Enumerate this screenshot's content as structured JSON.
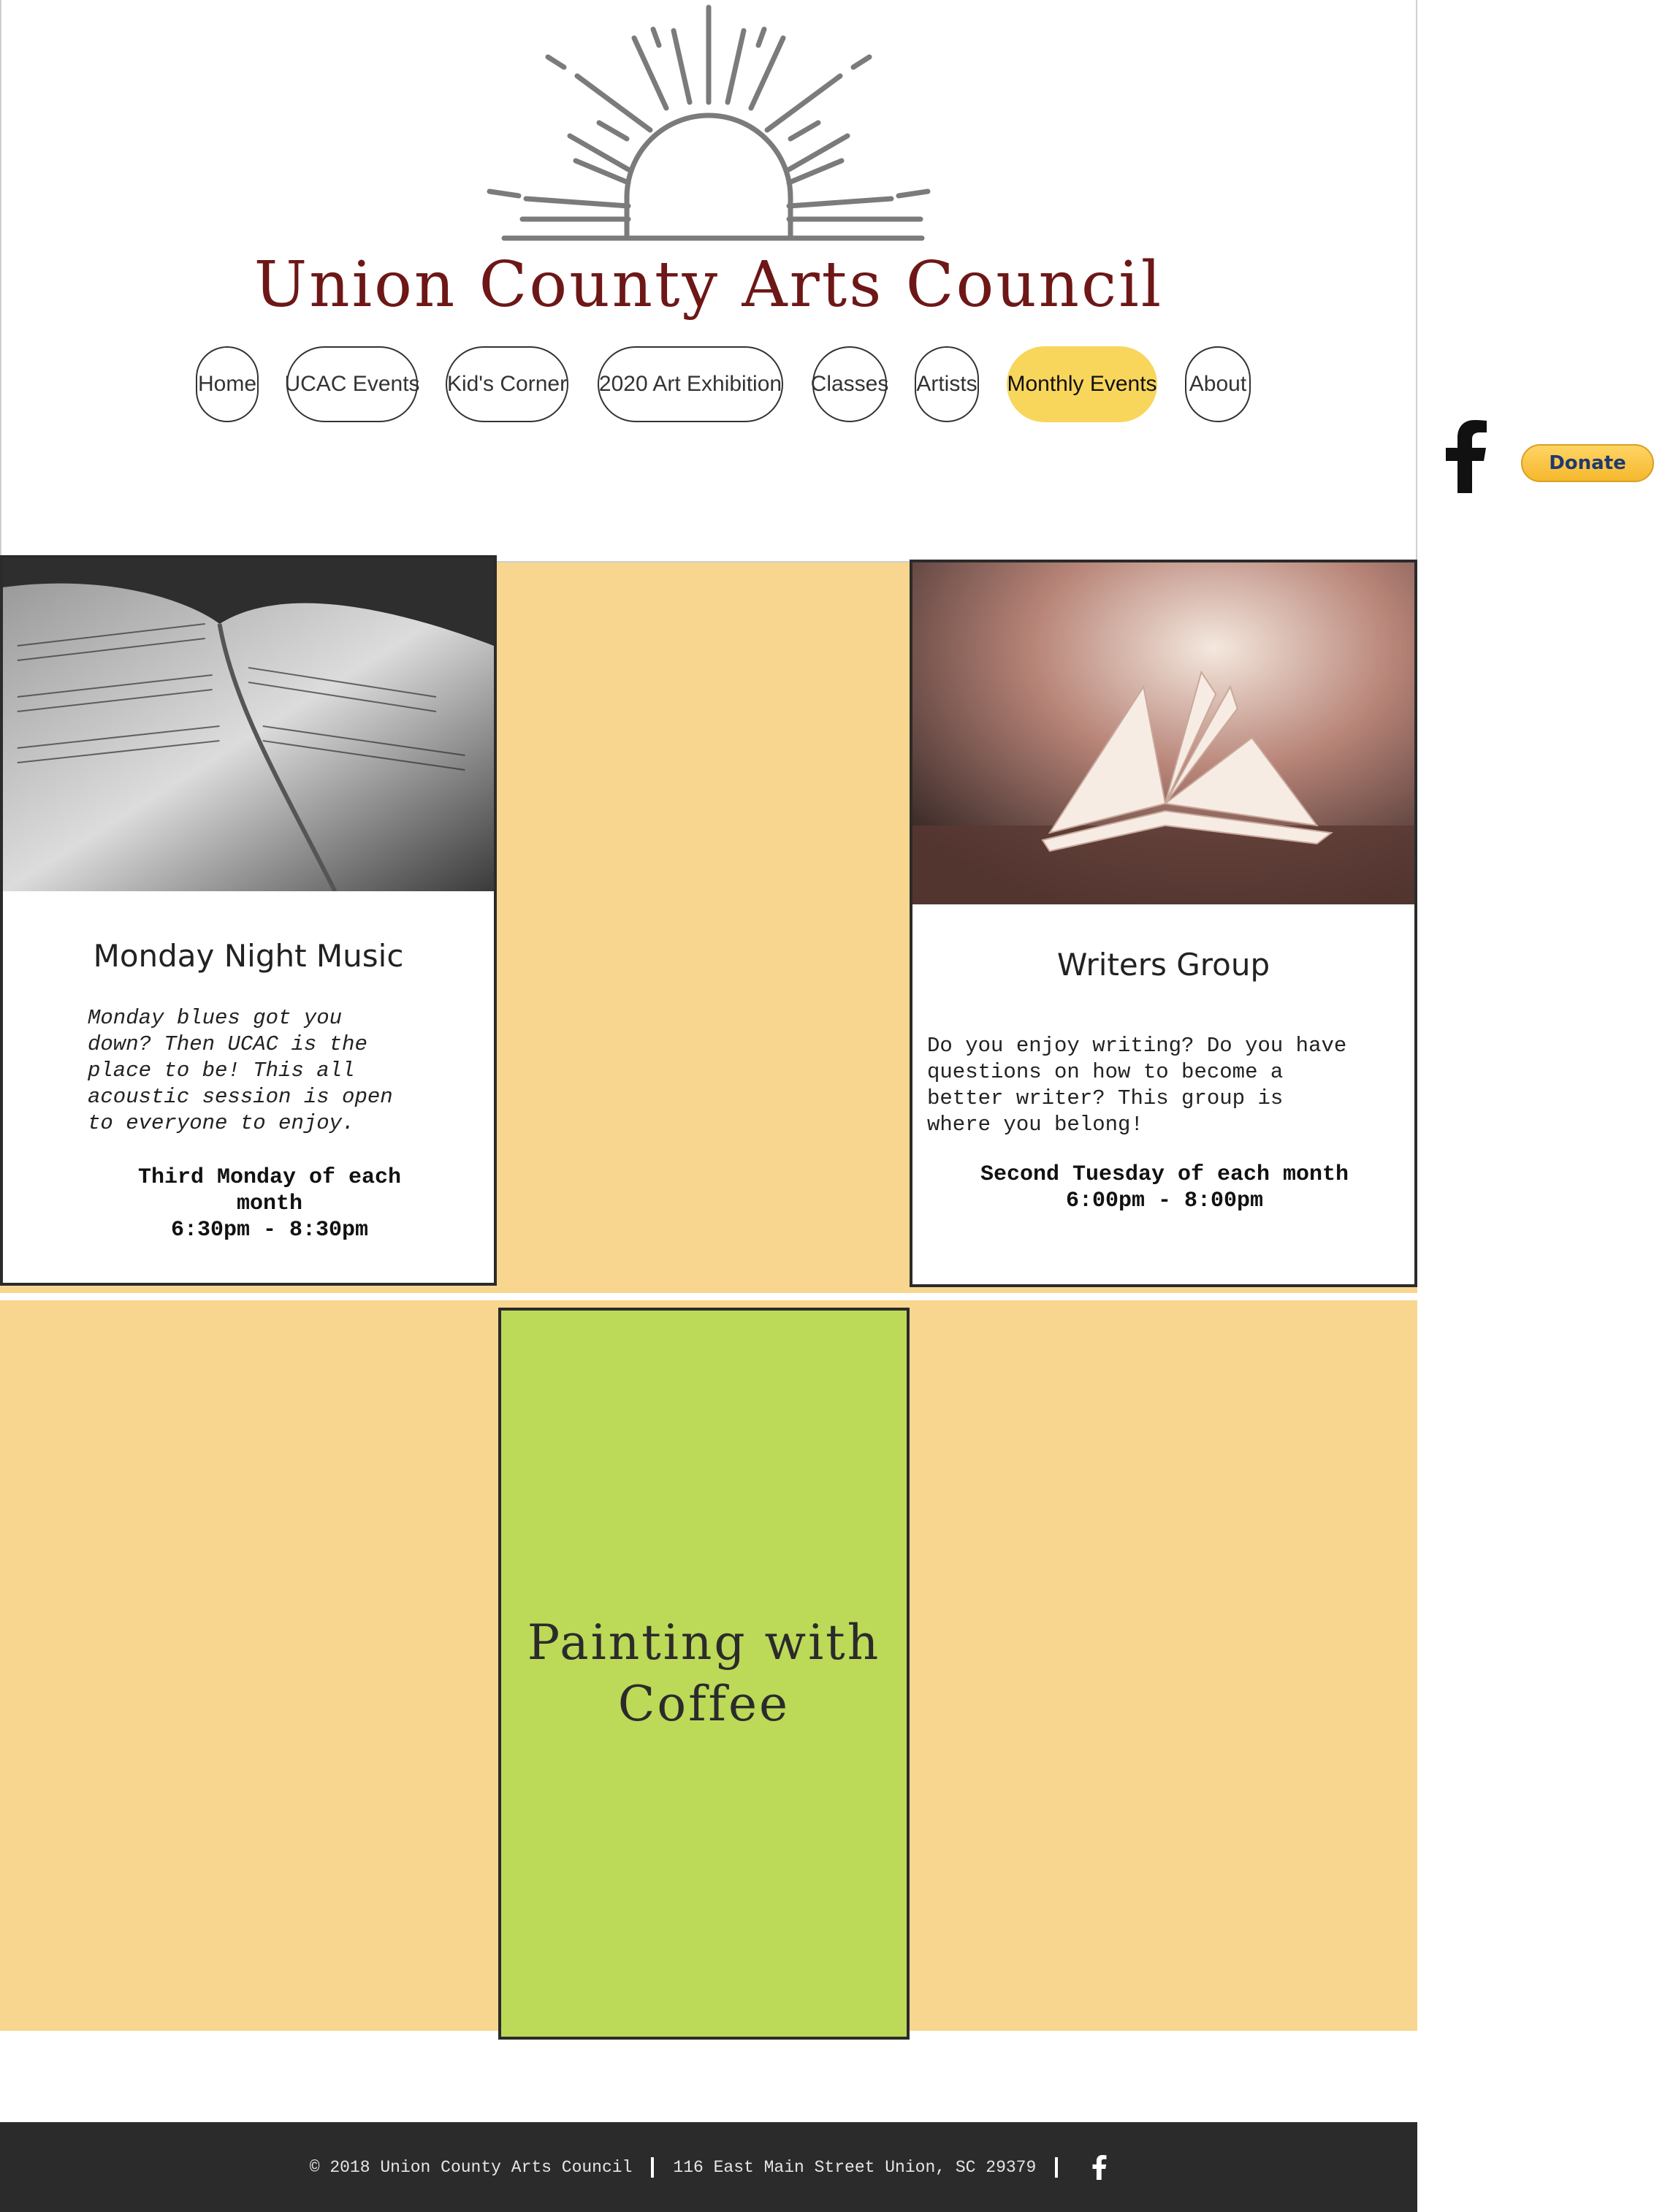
{
  "site": {
    "title": "Union County Arts Council"
  },
  "nav": [
    {
      "label": "Home",
      "active": false
    },
    {
      "label": "UCAC Events",
      "active": false
    },
    {
      "label": "Kid's Corner",
      "active": false
    },
    {
      "label": "2020 Art Exhibition",
      "active": false
    },
    {
      "label": "Classes",
      "active": false
    },
    {
      "label": "Artists",
      "active": false
    },
    {
      "label": "Monthly Events",
      "active": true
    },
    {
      "label": "About",
      "active": false
    }
  ],
  "social": {
    "facebook_icon": "facebook-icon",
    "donate_label": "Donate"
  },
  "events": {
    "music": {
      "title": "Monday Night Music",
      "description_lines": [
        "Monday blues got you",
        "down? Then UCAC is the",
        "place to be! This all",
        "acoustic session is open",
        "to everyone to enjoy."
      ],
      "when_lines": [
        "Third Monday of each",
        "month",
        "6:30pm - 8:30pm"
      ]
    },
    "writers": {
      "title": "Writers Group",
      "description_lines": [
        "Do you enjoy writing? Do you have",
        "questions on how to become a",
        "better writer? This group is",
        "where you belong!"
      ],
      "when_lines": [
        "Second Tuesday of each month",
        "6:00pm - 8:00pm"
      ]
    },
    "painting": {
      "title_lines": [
        "Painting with",
        "Coffee"
      ]
    }
  },
  "footer": {
    "copyright": "© 2018 Union County Arts Council",
    "address": "116 East Main Street Union, SC 29379",
    "facebook_icon": "facebook-icon"
  },
  "colors": {
    "title": "#6e1717",
    "nav_active": "#f8d65c",
    "events_bg": "#f8d690",
    "painting_bg": "#bcd958",
    "footer_bg": "#2b2b2b"
  }
}
